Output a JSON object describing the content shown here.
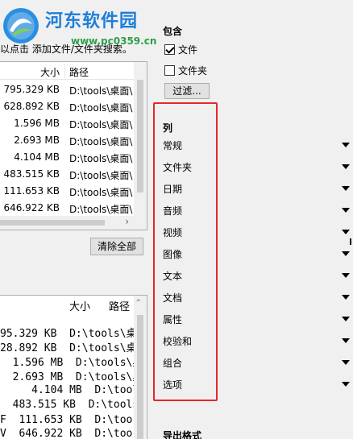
{
  "watermark": {
    "site_name": "河东软件园",
    "url": "www.pc0359.cn"
  },
  "hint_text": "以点击 添加文件/文件夹搜索。",
  "list1": {
    "columns": [
      "大小",
      "路径"
    ],
    "rows": [
      {
        "size": "795.329 KB",
        "path": "D:\\tools\\桌面\\"
      },
      {
        "size": "628.892 KB",
        "path": "D:\\tools\\桌面\\"
      },
      {
        "size": "1.596 MB",
        "path": "D:\\tools\\桌面\\"
      },
      {
        "size": "2.693 MB",
        "path": "D:\\tools\\桌面\\"
      },
      {
        "size": "4.104 MB",
        "path": "D:\\tools\\桌面\\"
      },
      {
        "size": "483.515 KB",
        "path": "D:\\tools\\桌面\\"
      },
      {
        "size": "111.653 KB",
        "path": "D:\\tools\\桌面\\"
      },
      {
        "size": "646.922 KB",
        "path": "D:\\tools\\桌面\\"
      }
    ],
    "scroll_right": "›"
  },
  "clear_all_label": "清除全部",
  "list2": {
    "columns": [
      "大小",
      "路径"
    ],
    "rows": [
      "95.329 KB  D:\\tools\\桌",
      "28.892 KB  D:\\tools\\桌",
      "  1.596 MB  D:\\tools\\桌",
      "  2.693 MB  D:\\tools\\桌",
      "     4.104 MB  D:\\tools\\",
      "  483.515 KB  D:\\tools",
      "F  111.653 KB  D:\\too",
      "V  646.922 KB  D:\\too"
    ],
    "scroll_up": "^"
  },
  "include": {
    "title": "包含",
    "file_label": "文件",
    "folder_label": "文件夹",
    "filter_label": "过滤..."
  },
  "columns_section": {
    "title": "列",
    "items": [
      "常规",
      "文件夹",
      "日期",
      "音频",
      "视频",
      "图像",
      "文本",
      "文档",
      "属性",
      "校验和",
      "组合",
      "选项"
    ]
  },
  "export": {
    "title": "导出格式"
  },
  "colors": {
    "highlight_border": "#e8262a",
    "watermark_blue": "#1e7fd8",
    "watermark_green": "#2aa04a"
  }
}
